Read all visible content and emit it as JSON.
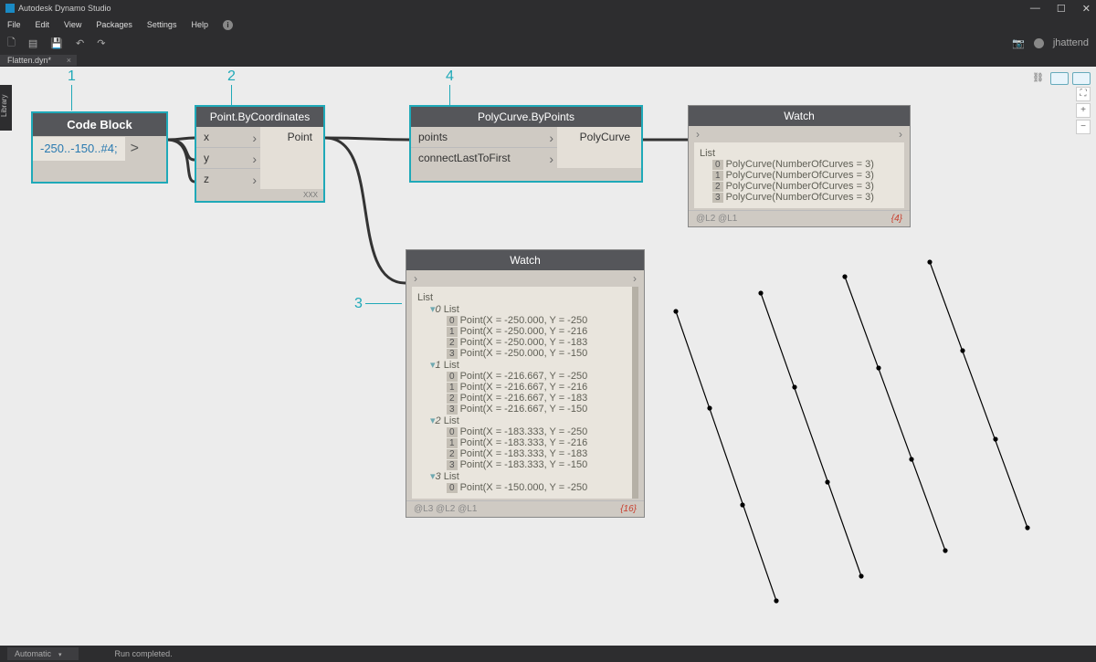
{
  "app": {
    "title": "Autodesk Dynamo Studio",
    "user": "jhattend"
  },
  "menu": [
    "File",
    "Edit",
    "View",
    "Packages",
    "Settings",
    "Help"
  ],
  "tab": {
    "name": "Flatten.dyn*"
  },
  "annotations": {
    "a1": "1",
    "a2": "2",
    "a3": "3",
    "a4": "4"
  },
  "codeblock": {
    "title": "Code Block",
    "code": "-250..-150..#4;",
    "out": ">"
  },
  "pointNode": {
    "title": "Point.ByCoordinates",
    "ins": [
      "x",
      "y",
      "z"
    ],
    "out": "Point",
    "footer": "XXX"
  },
  "polyNode": {
    "title": "PolyCurve.ByPoints",
    "ins": [
      "points",
      "connectLastToFirst"
    ],
    "out": "PolyCurve"
  },
  "watch1": {
    "title": "Watch",
    "header": "List",
    "rows": [
      "PolyCurve(NumberOfCurves = 3)",
      "PolyCurve(NumberOfCurves = 3)",
      "PolyCurve(NumberOfCurves = 3)",
      "PolyCurve(NumberOfCurves = 3)"
    ],
    "levels": "@L2 @L1",
    "count": "{4}"
  },
  "watch2": {
    "title": "Watch",
    "levels": "@L3 @L2 @L1",
    "count": "{16}",
    "content": [
      {
        "t": "head",
        "v": "List"
      },
      {
        "t": "sub",
        "i": "0",
        "v": "List"
      },
      {
        "t": "row",
        "i": "0",
        "v": "Point(X = -250.000, Y = -250"
      },
      {
        "t": "row",
        "i": "1",
        "v": "Point(X = -250.000, Y = -216"
      },
      {
        "t": "row",
        "i": "2",
        "v": "Point(X = -250.000, Y = -183"
      },
      {
        "t": "row",
        "i": "3",
        "v": "Point(X = -250.000, Y = -150"
      },
      {
        "t": "sub",
        "i": "1",
        "v": "List"
      },
      {
        "t": "row",
        "i": "0",
        "v": "Point(X = -216.667, Y = -250"
      },
      {
        "t": "row",
        "i": "1",
        "v": "Point(X = -216.667, Y = -216"
      },
      {
        "t": "row",
        "i": "2",
        "v": "Point(X = -216.667, Y = -183"
      },
      {
        "t": "row",
        "i": "3",
        "v": "Point(X = -216.667, Y = -150"
      },
      {
        "t": "sub",
        "i": "2",
        "v": "List"
      },
      {
        "t": "row",
        "i": "0",
        "v": "Point(X = -183.333, Y = -250"
      },
      {
        "t": "row",
        "i": "1",
        "v": "Point(X = -183.333, Y = -216"
      },
      {
        "t": "row",
        "i": "2",
        "v": "Point(X = -183.333, Y = -183"
      },
      {
        "t": "row",
        "i": "3",
        "v": "Point(X = -183.333, Y = -150"
      },
      {
        "t": "sub",
        "i": "3",
        "v": "List"
      },
      {
        "t": "row",
        "i": "0",
        "v": "Point(X = -150.000, Y = -250"
      }
    ]
  },
  "status": {
    "mode": "Automatic",
    "msg": "Run completed."
  },
  "library": "Library"
}
